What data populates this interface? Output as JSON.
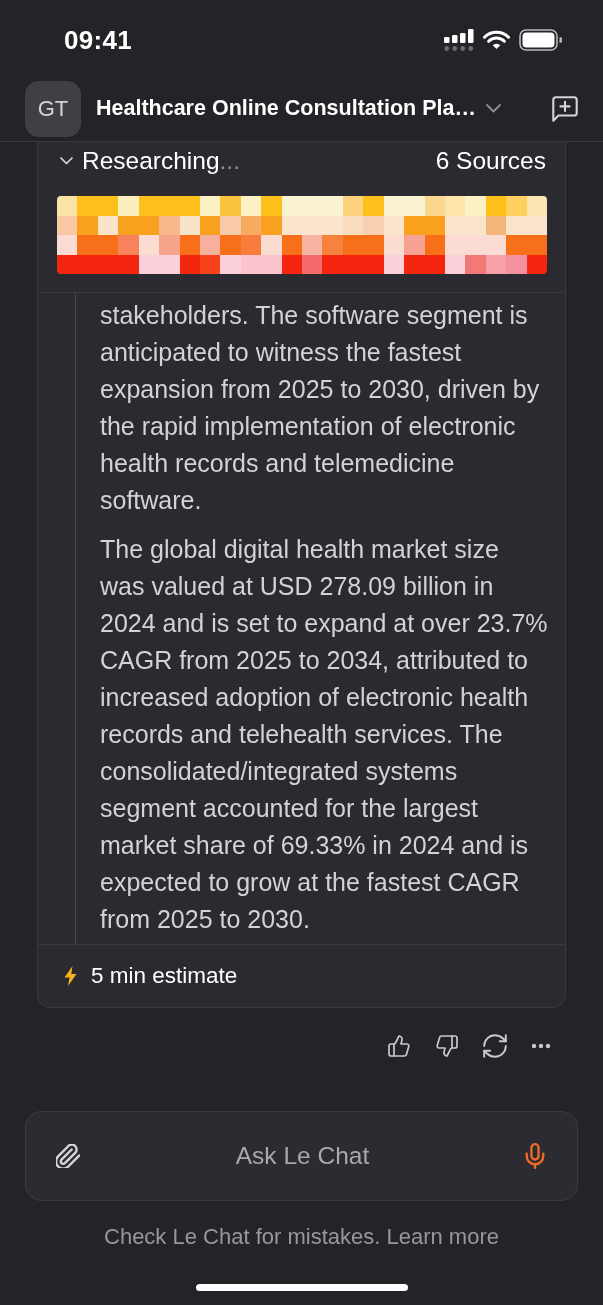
{
  "status_bar": {
    "time": "09:41"
  },
  "header": {
    "avatar": "GT",
    "title": "Healthcare Online Consultation Pla…"
  },
  "research_card": {
    "expanded": true,
    "status": "Researching",
    "status_ellipsis": "...",
    "sources": "6 Sources",
    "paragraphs": [
      "stakeholders. The software segment is anticipated to witness the fastest expansion from 2025 to 2030, driven by the rapid implementation of electronic health records and telemedicine software.",
      "The global digital health market size was valued at USD 278.09 billion in 2024 and is set to expand at over 23.7% CAGR from 2025 to 2034, attributed to increased adoption of electronic health records and telehealth services. The consolidated/integrated systems segment accounted for the largest market share of 69.33% in 2024 and is expected to grow at the fastest CAGR from 2025 to 2030."
    ],
    "estimate": "5 min estimate"
  },
  "composer": {
    "placeholder": "Ask Le Chat"
  },
  "footer": {
    "text": "Check Le Chat for mistakes.",
    "link": "Learn more"
  }
}
